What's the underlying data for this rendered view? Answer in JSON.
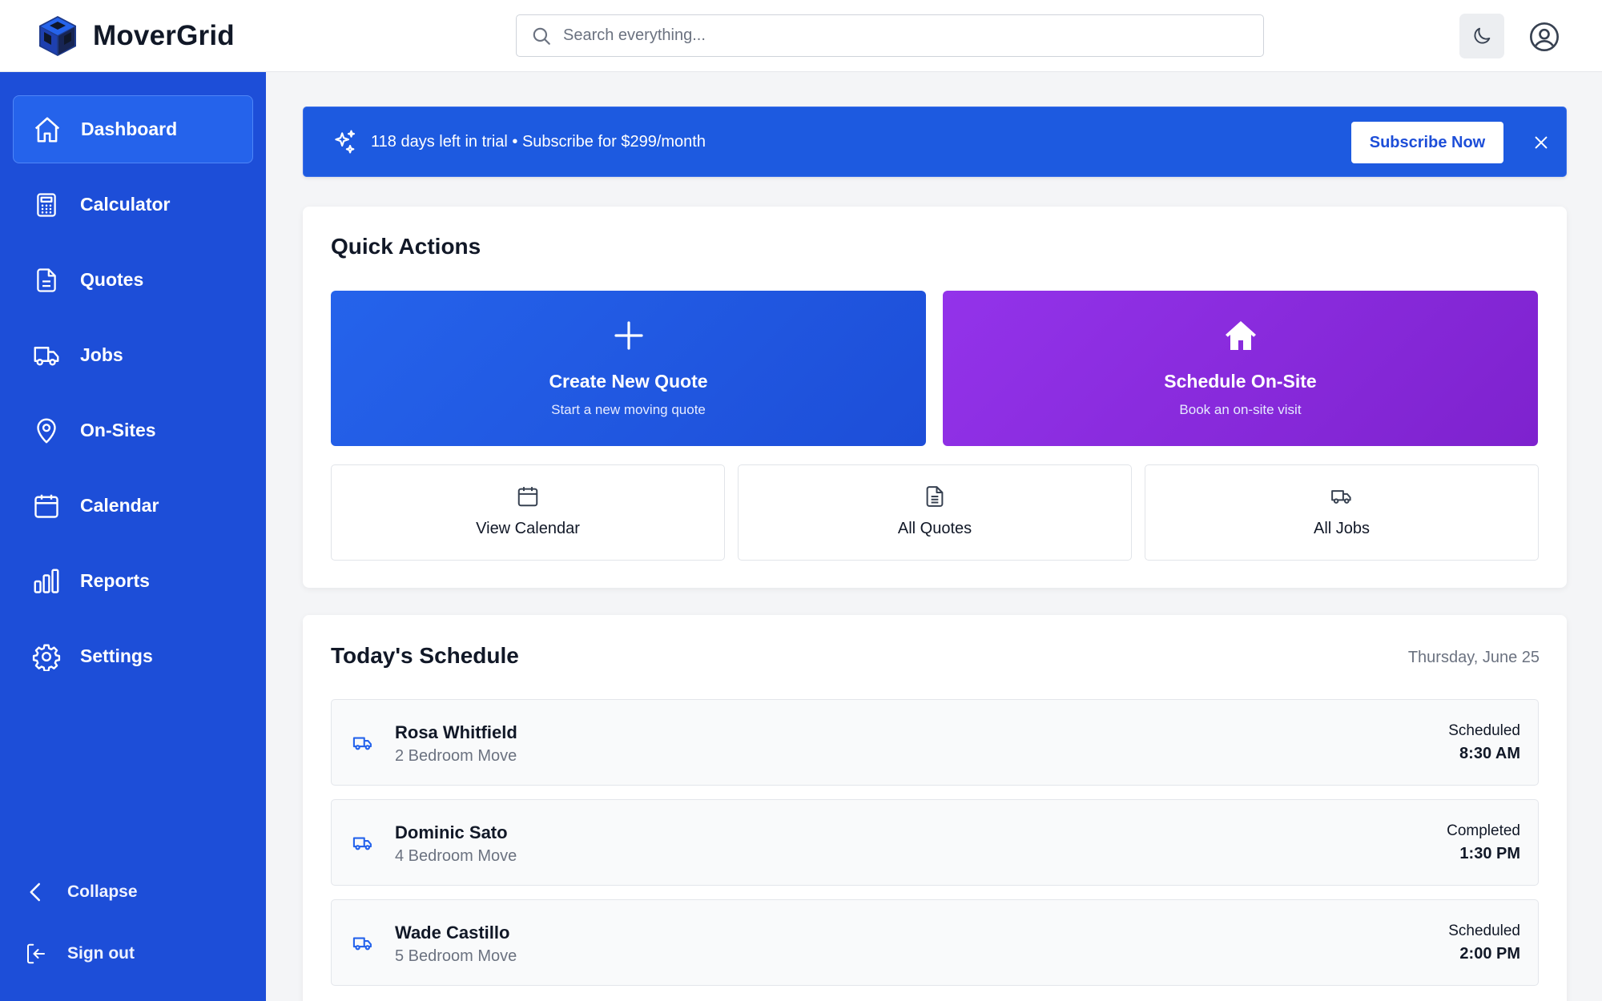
{
  "app": {
    "name": "MoverGrid"
  },
  "search": {
    "placeholder": "Search everything..."
  },
  "header": {
    "theme_icon": "moon-icon",
    "profile_icon": "user-circle-icon"
  },
  "sidebar": {
    "items": [
      {
        "label": "Dashboard",
        "icon": "home-icon",
        "active": true
      },
      {
        "label": "Calculator",
        "icon": "calculator-icon"
      },
      {
        "label": "Quotes",
        "icon": "document-icon"
      },
      {
        "label": "Jobs",
        "icon": "truck-icon"
      },
      {
        "label": "On-Sites",
        "icon": "map-pin-icon"
      },
      {
        "label": "Calendar",
        "icon": "calendar-icon"
      },
      {
        "label": "Reports",
        "icon": "bar-chart-icon"
      },
      {
        "label": "Settings",
        "icon": "gear-icon"
      }
    ],
    "collapse_label": "Collapse",
    "signout_label": "Sign out"
  },
  "trial_banner": {
    "text": "118 days left in trial • Subscribe for $299/month",
    "button_label": "Subscribe Now"
  },
  "quick_actions": {
    "title": "Quick Actions",
    "primary": [
      {
        "title": "Create New Quote",
        "subtitle": "Start a new moving quote",
        "icon": "plus-icon",
        "color": "#2563eb"
      },
      {
        "title": "Schedule On-Site",
        "subtitle": "Book an on-site visit",
        "icon": "home-icon",
        "color": "#9333ea"
      }
    ],
    "secondary": [
      {
        "label": "View Calendar",
        "icon": "calendar-icon"
      },
      {
        "label": "All Quotes",
        "icon": "document-icon"
      },
      {
        "label": "All Jobs",
        "icon": "truck-icon"
      }
    ]
  },
  "schedule": {
    "title": "Today's Schedule",
    "date": "Thursday, June 25",
    "rows": [
      {
        "name": "Rosa Whitfield",
        "move": "2 Bedroom Move",
        "status": "Scheduled",
        "time": "8:30 AM"
      },
      {
        "name": "Dominic Sato",
        "move": "4 Bedroom Move",
        "status": "Completed",
        "time": "1:30 PM"
      },
      {
        "name": "Wade Castillo",
        "move": "5 Bedroom Move",
        "status": "Scheduled",
        "time": "2:00 PM"
      }
    ]
  },
  "colors": {
    "sidebar": "#1d4ed8",
    "accent": "#2563eb",
    "purple": "#9333ea"
  }
}
